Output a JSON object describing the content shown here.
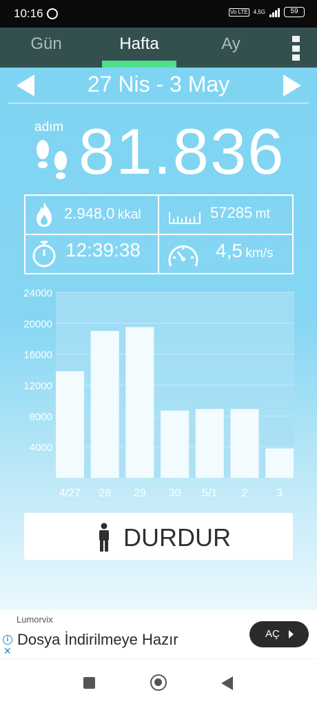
{
  "status_bar": {
    "time": "10:16",
    "network": "4,5G",
    "volte": "Vo LTE",
    "battery": "59"
  },
  "tabs": [
    {
      "label": "Gün",
      "active": false
    },
    {
      "label": "Hafta",
      "active": true
    },
    {
      "label": "Ay",
      "active": false
    }
  ],
  "date_range": "27 Nis - 3 May",
  "steps": {
    "label": "adım",
    "value": "81.836"
  },
  "stats": {
    "calories": {
      "value": "2.948,0",
      "unit": "kkal",
      "icon": "flame-icon"
    },
    "distance": {
      "value": "57285",
      "unit": "mt",
      "icon": "ruler-icon"
    },
    "duration": {
      "value": "12:39:38",
      "icon": "stopwatch-icon"
    },
    "speed": {
      "value": "4,5",
      "unit": "km/s",
      "icon": "speedometer-icon"
    }
  },
  "chart_data": {
    "type": "bar",
    "categories": [
      "4/27",
      "28",
      "29",
      "30",
      "5/1",
      "2",
      "3"
    ],
    "values": [
      13800,
      19000,
      19500,
      8700,
      8900,
      8900,
      3800
    ],
    "y_ticks": [
      "4000",
      "8000",
      "12000",
      "16000",
      "20000",
      "24000"
    ],
    "ylim": [
      0,
      24000
    ],
    "grid": true,
    "bar_color": "#f2fbfe",
    "plot_color": "#a8dff4"
  },
  "stop_button": {
    "label": "DURDUR",
    "icon": "person-icon"
  },
  "ad": {
    "brand": "Lumorvix",
    "title": "Dosya İndirilmeye Hazır",
    "button_label": "AÇ"
  },
  "colors": {
    "tab_bar": "#33504f",
    "tab_indicator": "#4fe08a",
    "background_top": "#7dd4f2"
  }
}
